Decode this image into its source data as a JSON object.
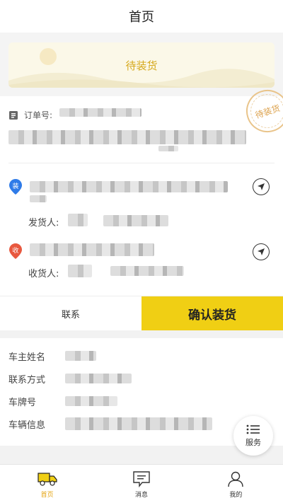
{
  "header": {
    "title": "首页"
  },
  "banner": {
    "status": "待装货"
  },
  "stamp": {
    "text": "待装货"
  },
  "order": {
    "order_no_label": "订单号:",
    "load_badge": "装",
    "unload_badge": "收",
    "shipper_label": "发货人:",
    "receiver_label": "收货人:"
  },
  "actions": {
    "contact": "联系",
    "confirm_load": "确认装货"
  },
  "vehicle": {
    "owner_name_label": "车主姓名",
    "contact_label": "联系方式",
    "plate_label": "车牌号",
    "info_label": "车辆信息"
  },
  "service": {
    "label": "服务"
  },
  "tabbar": {
    "items": [
      {
        "label": "首页",
        "icon": "truck-icon",
        "active": true
      },
      {
        "label": "消息",
        "icon": "message-icon",
        "active": false
      },
      {
        "label": "我的",
        "icon": "user-icon",
        "active": false
      }
    ]
  },
  "colors": {
    "accent": "#f0cf14",
    "active_tab": "#e5a412",
    "load_badge": "#2f7be8",
    "unload_badge": "#e8583f"
  }
}
